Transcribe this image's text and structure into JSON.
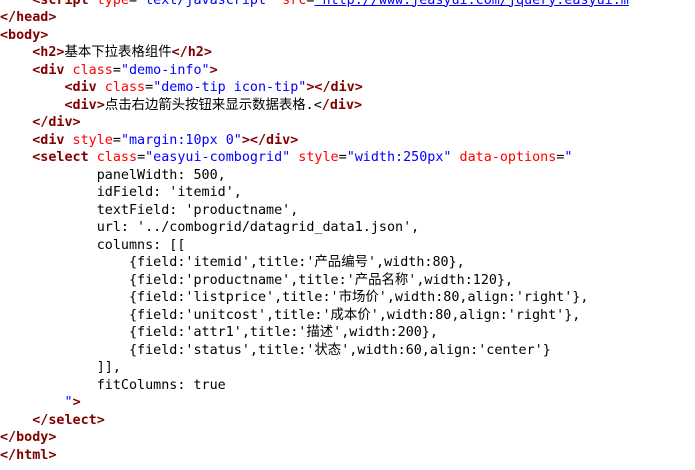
{
  "colors": {
    "background": "#ffffff",
    "tag": "#800000",
    "attribute": "#ff0000",
    "value": "#0000ff",
    "text": "#000000"
  },
  "lines": [
    [
      {
        "c": "txt",
        "t": "    "
      },
      {
        "c": "tag",
        "t": "<script"
      },
      {
        "c": "attr",
        "t": " type"
      },
      {
        "c": "txt",
        "t": "="
      },
      {
        "c": "val",
        "t": "\"text/javascript\""
      },
      {
        "c": "attr",
        "t": " src"
      },
      {
        "c": "txt",
        "t": "="
      },
      {
        "c": "link",
        "t": "\"http://www.jeasyui.com/jquery.easyui.m"
      }
    ],
    [
      {
        "c": "tag",
        "t": "</head>"
      }
    ],
    [
      {
        "c": "tag",
        "t": "<body>"
      }
    ],
    [
      {
        "c": "txt",
        "t": "    "
      },
      {
        "c": "tag",
        "t": "<h2>"
      },
      {
        "c": "txt",
        "t": "基本下拉表格组件"
      },
      {
        "c": "tag",
        "t": "</h2>"
      }
    ],
    [
      {
        "c": "txt",
        "t": "    "
      },
      {
        "c": "tag",
        "t": "<div"
      },
      {
        "c": "attr",
        "t": " class"
      },
      {
        "c": "txt",
        "t": "="
      },
      {
        "c": "val",
        "t": "\"demo-info\""
      },
      {
        "c": "tag",
        "t": ">"
      }
    ],
    [
      {
        "c": "txt",
        "t": "        "
      },
      {
        "c": "tag",
        "t": "<div"
      },
      {
        "c": "attr",
        "t": " class"
      },
      {
        "c": "txt",
        "t": "="
      },
      {
        "c": "val",
        "t": "\"demo-tip icon-tip\""
      },
      {
        "c": "tag",
        "t": "></div>"
      }
    ],
    [
      {
        "c": "txt",
        "t": "        "
      },
      {
        "c": "tag",
        "t": "<div>"
      },
      {
        "c": "txt",
        "t": "点击右边箭头按钮来显示数据表格.<"
      },
      {
        "c": "tag",
        "t": "/div>"
      }
    ],
    [
      {
        "c": "txt",
        "t": "    "
      },
      {
        "c": "tag",
        "t": "</div>"
      }
    ],
    [
      {
        "c": "txt",
        "t": "    "
      },
      {
        "c": "tag",
        "t": "<div"
      },
      {
        "c": "attr",
        "t": " style"
      },
      {
        "c": "txt",
        "t": "="
      },
      {
        "c": "val",
        "t": "\"margin:10px 0\""
      },
      {
        "c": "tag",
        "t": "></div>"
      }
    ],
    [
      {
        "c": "txt",
        "t": "    "
      },
      {
        "c": "tag",
        "t": "<select"
      },
      {
        "c": "attr",
        "t": " class"
      },
      {
        "c": "txt",
        "t": "="
      },
      {
        "c": "val",
        "t": "\"easyui-combogrid\""
      },
      {
        "c": "attr",
        "t": " style"
      },
      {
        "c": "txt",
        "t": "="
      },
      {
        "c": "val",
        "t": "\"width:250px\""
      },
      {
        "c": "attr",
        "t": " data-options"
      },
      {
        "c": "txt",
        "t": "="
      },
      {
        "c": "val",
        "t": "\""
      }
    ],
    [
      {
        "c": "txt",
        "t": "            panelWidth: 500,"
      }
    ],
    [
      {
        "c": "txt",
        "t": "            idField: 'itemid',"
      }
    ],
    [
      {
        "c": "txt",
        "t": "            textField: 'productname',"
      }
    ],
    [
      {
        "c": "txt",
        "t": "            url: '../combogrid/datagrid_data1.json',"
      }
    ],
    [
      {
        "c": "txt",
        "t": "            columns: [["
      }
    ],
    [
      {
        "c": "txt",
        "t": "                {field:'itemid',title:'产品编号',width:80},"
      }
    ],
    [
      {
        "c": "txt",
        "t": "                {field:'productname',title:'产品名称',width:120},"
      }
    ],
    [
      {
        "c": "txt",
        "t": "                {field:'listprice',title:'市场价',width:80,align:'right'},"
      }
    ],
    [
      {
        "c": "txt",
        "t": "                {field:'unitcost',title:'成本价',width:80,align:'right'},"
      }
    ],
    [
      {
        "c": "txt",
        "t": "                {field:'attr1',title:'描述',width:200},"
      }
    ],
    [
      {
        "c": "txt",
        "t": "                {field:'status',title:'状态',width:60,align:'center'}"
      }
    ],
    [
      {
        "c": "txt",
        "t": "            ]],"
      }
    ],
    [
      {
        "c": "txt",
        "t": "            fitColumns: true"
      }
    ],
    [
      {
        "c": "txt",
        "t": "        "
      },
      {
        "c": "val",
        "t": "\""
      },
      {
        "c": "tag",
        "t": ">"
      }
    ],
    [
      {
        "c": "txt",
        "t": "    "
      },
      {
        "c": "tag",
        "t": "</select>"
      }
    ],
    [
      {
        "c": "tag",
        "t": "</body>"
      }
    ],
    [
      {
        "c": "tag",
        "t": "</html>"
      }
    ]
  ]
}
